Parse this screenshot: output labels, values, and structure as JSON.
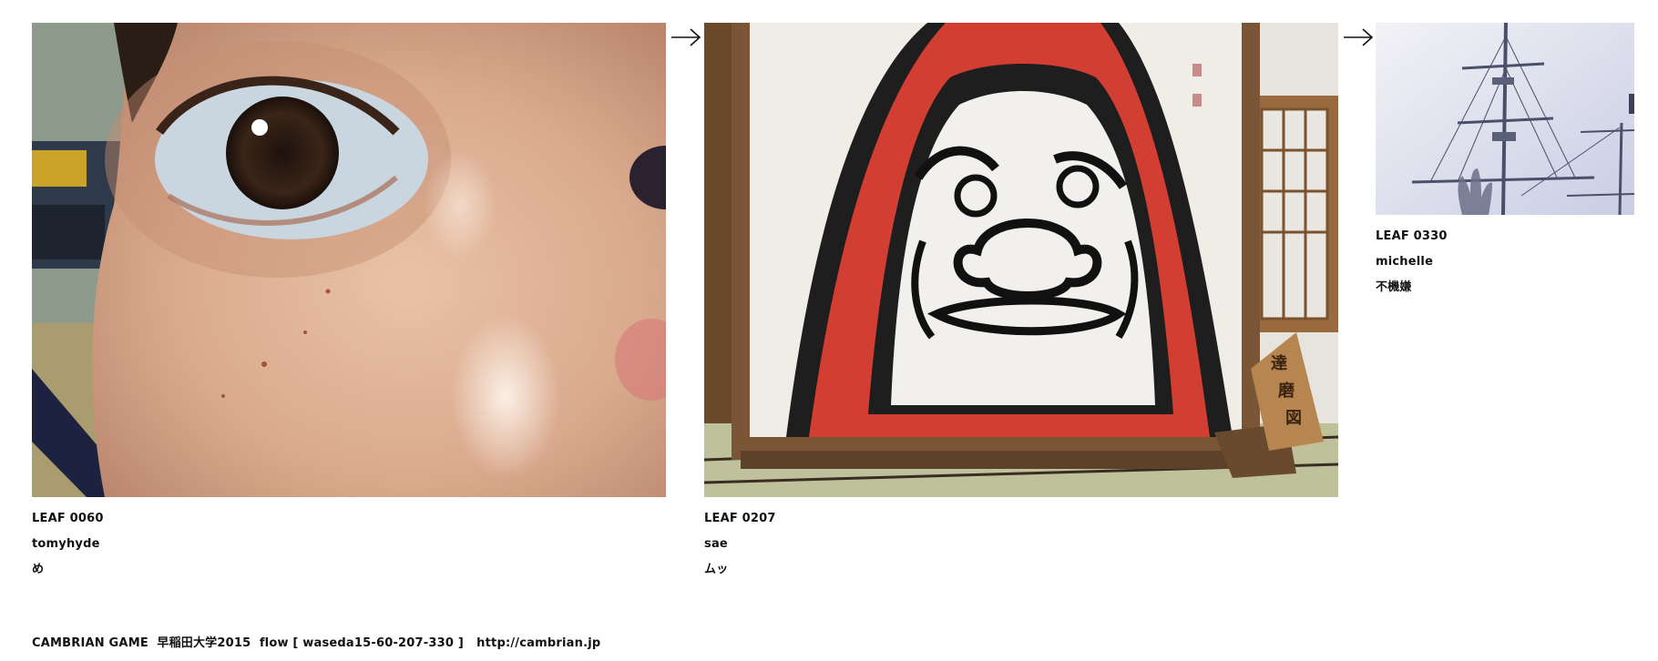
{
  "leaves": [
    {
      "id": "LEAF 0060",
      "user": "tomyhyde",
      "comment": "め",
      "photo_subject": "close-up eye"
    },
    {
      "id": "LEAF 0207",
      "user": "sae",
      "comment": "ムッ",
      "photo_subject": "daruma folding screen"
    },
    {
      "id": "LEAF 0330",
      "user": "michelle",
      "comment": "不機嫌",
      "photo_subject": "ship masts"
    }
  ],
  "arrow_icon": "right-arrow-icon",
  "footer": {
    "game": "CAMBRIAN GAME",
    "venue": "早稲田大学2015",
    "flow": "flow [ waseda15-60-207-330 ]",
    "url": "http://cambrian.jp"
  }
}
